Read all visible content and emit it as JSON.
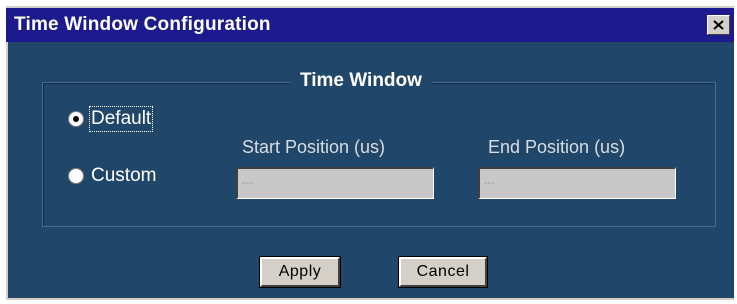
{
  "window": {
    "title": "Time Window Configuration",
    "close_icon": "close-icon"
  },
  "group": {
    "legend": "Time Window"
  },
  "radios": {
    "default_label": "Default",
    "default_checked": true,
    "custom_label": "Custom",
    "custom_checked": false
  },
  "fields": {
    "start_label": "Start Position (us)",
    "start_value": "---",
    "end_label": "End Position (us)",
    "end_value": "---"
  },
  "buttons": {
    "apply_label": "Apply",
    "cancel_label": "Cancel"
  },
  "colors": {
    "titlebar": "#1c1a8c",
    "panel": "#20466a",
    "button_face": "#d4d0c8",
    "disabled_field": "#c8c8c8"
  }
}
